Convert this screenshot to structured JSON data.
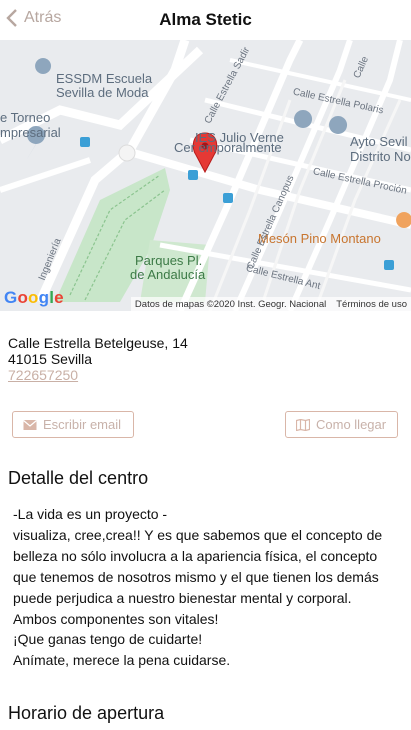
{
  "header": {
    "back_label": "Atrás",
    "title": "Alma Stetic"
  },
  "map": {
    "labels": {
      "essdm_1": "ESSDM Escuela",
      "essdm_2": "Sevilla de Moda",
      "torneo": "e Torneo",
      "empresarial": "mpresarial",
      "ies_1": "IES Julio Verne",
      "ies_2": "Cer    emporalmente",
      "ayto_1": "Ayto Sevil",
      "ayto_2": "Distrito No",
      "parques_1": "Parques Pl.",
      "parques_2": "de Andalucía",
      "meson": "Mesón Pino Montano",
      "st_sadir": "Calle Estrella Sadir",
      "st_polaris": "Calle Estrella Polaris",
      "st_procion": "Calle Estrella Proción",
      "st_canopus": "Calle Estrella Canopus",
      "st_antares": "Calle Estrella Ant",
      "st_ingenieria": "Ingeniería",
      "st_calle": "Calle"
    },
    "logo": "Google",
    "attribution": "Datos de mapas ©2020 Inst. Geogr. Nacional",
    "terms": "Términos de uso"
  },
  "address": {
    "line1": "Calle Estrella Betelgeuse, 14",
    "line2": "41015 Sevilla",
    "phone": "722657250"
  },
  "actions": {
    "email_label": "Escribir email",
    "directions_label": "Como llegar"
  },
  "details": {
    "title": "Detalle del centro",
    "lines": [
      "-La vida es un proyecto -",
      "visualiza, cree,crea!! Y es que sabemos que el concepto de",
      "belleza no sólo involucra a la apariencia física, el concepto",
      "que tenemos de nosotros mismo y el que tienen los demás",
      "puede perjudica a nuestro bienestar mental y corporal.",
      "Ambos componentes son vitales!",
      "¡Que ganas tengo de cuidarte!",
      "Anímate, merece la pena cuidarse."
    ]
  },
  "hours": {
    "title": "Horario de apertura"
  },
  "colors": {
    "accent": "#d9b6a8",
    "accent_text": "#c8b2aa",
    "marker": "#e53935"
  }
}
